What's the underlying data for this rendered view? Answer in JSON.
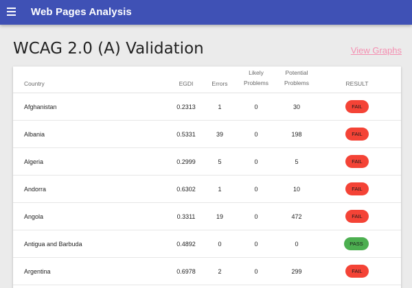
{
  "appbar": {
    "menu_icon": "hamburger-menu-icon",
    "title": "Web Pages Analysis"
  },
  "page": {
    "title": "WCAG 2.0 (A) Validation",
    "view_graphs": "View Graphs"
  },
  "colors": {
    "appbar": "#3f51b5",
    "fail": "#f44336",
    "pass": "#4caf50",
    "link": "#f48fb1"
  },
  "table": {
    "headers": {
      "country": "Country",
      "egdi": "EGDI",
      "errors": "Errors",
      "likely_1": "Likely",
      "likely_2": "Problems",
      "potential_1": "Potential",
      "potential_2": "Problems",
      "result": "RESULT"
    },
    "rows": [
      {
        "country": "Afghanistan",
        "egdi": "0.2313",
        "errors": "1",
        "likely": "0",
        "potential": "30",
        "result": "FAIL"
      },
      {
        "country": "Albania",
        "egdi": "0.5331",
        "errors": "39",
        "likely": "0",
        "potential": "198",
        "result": "FAIL"
      },
      {
        "country": "Algeria",
        "egdi": "0.2999",
        "errors": "5",
        "likely": "0",
        "potential": "5",
        "result": "FAIL"
      },
      {
        "country": "Andorra",
        "egdi": "0.6302",
        "errors": "1",
        "likely": "0",
        "potential": "10",
        "result": "FAIL"
      },
      {
        "country": "Angola",
        "egdi": "0.3311",
        "errors": "19",
        "likely": "0",
        "potential": "472",
        "result": "FAIL"
      },
      {
        "country": "Antigua and Barbuda",
        "egdi": "0.4892",
        "errors": "0",
        "likely": "0",
        "potential": "0",
        "result": "PASS"
      },
      {
        "country": "Argentina",
        "egdi": "0.6978",
        "errors": "2",
        "likely": "0",
        "potential": "299",
        "result": "FAIL"
      }
    ]
  }
}
